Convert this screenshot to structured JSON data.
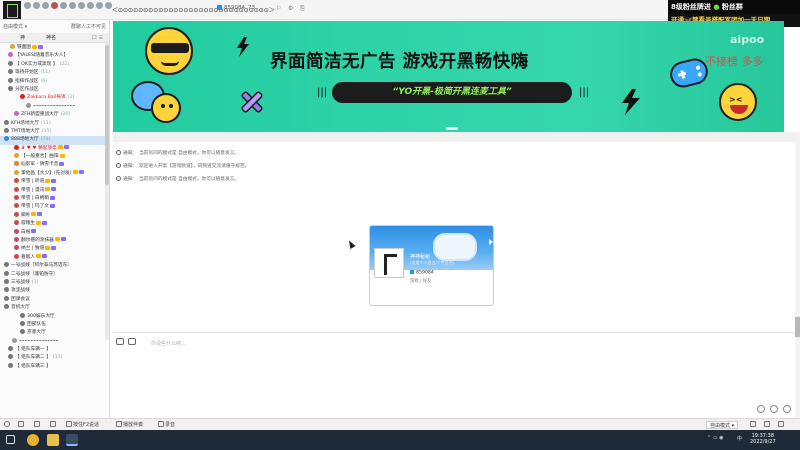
{
  "topbar": {
    "title": "＜⊙⊙⊙⊙⊙⊙⊙⊙⊙⊙⊙⊙⊙⊙⊙⊙⊙⊙⊙⊙⊙⊙⊙⊙⊙⊙⊙⊙⊙⊙＞",
    "channel_id": "859084",
    "people": "73",
    "icons": [
      "logo-icon",
      "group-icon",
      "chat-icon",
      "mute-icon",
      "settings-icon"
    ]
  },
  "overlay": {
    "line1_a": "8级粉丝牌进",
    "line1_b": "粉丝群",
    "line2": "开通🦋禁看号搭配军团加一天日期"
  },
  "sidebar": {
    "mode_label": "自由模式 ▾",
    "search_hint": "群聊人工不可见",
    "col_left": "神",
    "col_mid": "神名",
    "col_right": "口 ☰",
    "rows": [
      {
        "text": "铁面图",
        "indent": 10,
        "color": "#d6a63a",
        "badges": [
          "#ffb400",
          "#8a6cff"
        ]
      },
      {
        "text": "【YALESI随着音乐大人】",
        "indent": 8,
        "color": "#c06ac0",
        "count": ""
      },
      {
        "text": "【 OK实力或黑现 】",
        "indent": 8,
        "color": "#777",
        "count": "(22)"
      },
      {
        "text": "等待开始区",
        "indent": 8,
        "color": "#777",
        "count": "(11)"
      },
      {
        "text": "指挥作战区",
        "indent": 8,
        "color": "#777",
        "count": "(6)"
      },
      {
        "text": "分区作战区",
        "indent": 8,
        "color": "#777",
        "count": ""
      },
      {
        "text": "Zakkara Ball导演",
        "indent": 20,
        "color": "#d22",
        "count": "(2)"
      },
      {
        "text": "⌁⌁⌁⌁⌁⌁⌁⌁⌁⌁⌁⌁⌁⌁⌁",
        "indent": 26,
        "color": "#999",
        "count": ""
      },
      {
        "text": "ZFH新盟重战大厅",
        "indent": 14,
        "color": "#c06ac0",
        "count": "(26)"
      },
      {
        "text": "KFH场地大厅",
        "indent": 4,
        "color": "#777",
        "count": "(11)"
      },
      {
        "text": "TMT场地大厅",
        "indent": 4,
        "color": "#777",
        "count": "(35)"
      },
      {
        "text": "888场地大厅",
        "indent": 4,
        "color": "#2c8fe6",
        "count": "(70)",
        "selected": true
      },
      {
        "text": "♛ ♥ ♥     精起放电",
        "indent": 14,
        "color": "#d22",
        "badges": [
          "#ffb400",
          "#8a6cff"
        ]
      },
      {
        "text": "【一般重合】曲阳",
        "indent": 14,
        "color": "#d6a63a",
        "badges": [
          "#ffb400"
        ]
      },
      {
        "text": "仙影军 - 倩雪卡音",
        "indent": 14,
        "color": "#e87c27",
        "badges": [
          "#8a6cff"
        ]
      },
      {
        "text": "掌他昌【大少】(先对发)",
        "indent": 14,
        "color": "#d6a63a",
        "badges": [
          "#ffb400",
          "#8a6cff"
        ]
      },
      {
        "text": "帝雪 | 听道",
        "indent": 14,
        "color": "#c05050",
        "badges": [
          "#ffb400",
          "#8a6cff"
        ]
      },
      {
        "text": "帝雪 | 漫讯",
        "indent": 14,
        "color": "#c05050",
        "badges": [
          "#ffb400",
          "#8a6cff"
        ]
      },
      {
        "text": "帝雪 | 白柄鞘",
        "indent": 14,
        "color": "#c05050",
        "badges": [
          "#8a6cff"
        ]
      },
      {
        "text": "帝雪 | 玛丁文",
        "indent": 14,
        "color": "#c05050",
        "badges": [
          "#8a6cff"
        ]
      },
      {
        "text": "脚朴",
        "indent": 14,
        "color": "#c05050",
        "badges": [
          "#ffb400",
          "#8a6cff"
        ]
      },
      {
        "text": "寂粮生",
        "indent": 14,
        "color": "#c05050",
        "badges": [
          "#ffb400",
          "#8a6cff"
        ]
      },
      {
        "text": "白根",
        "indent": 14,
        "color": "#c05050",
        "badges": [
          "#8a6cff"
        ]
      },
      {
        "text": "翻尔擅的涂抹器",
        "indent": 14,
        "color": "#c05050",
        "badges": [
          "#ffb400",
          "#8a6cff"
        ]
      },
      {
        "text": "纳兰 | 独值",
        "indent": 14,
        "color": "#c05050",
        "badges": [
          "#ffb400",
          "#8a6cff"
        ]
      },
      {
        "text": "看敌人",
        "indent": 14,
        "color": "#c05050",
        "badges": [
          "#ffb400",
          "#8a6cff"
        ]
      },
      {
        "text": "一号战线（阿尔泰马苏迈东）",
        "indent": 4,
        "color": "#777",
        "count": ""
      },
      {
        "text": "二号战线（蓬铂防守）",
        "indent": 4,
        "color": "#777",
        "count": ""
      },
      {
        "text": "三号战线",
        "indent": 4,
        "color": "#777",
        "count": "(1)"
      },
      {
        "text": "攻坚战线",
        "indent": 4,
        "color": "#777",
        "count": ""
      },
      {
        "text": "团课会议",
        "indent": 4,
        "color": "#777",
        "count": ""
      },
      {
        "text": "音机大厅",
        "indent": 4,
        "color": "#777",
        "count": ""
      },
      {
        "text": "300娱乐大厅",
        "indent": 20,
        "color": "#777",
        "count": ""
      },
      {
        "text": "团部队伍",
        "indent": 20,
        "color": "#777",
        "count": ""
      },
      {
        "text": "京墨大厅",
        "indent": 20,
        "color": "#777",
        "count": ""
      },
      {
        "text": "⌁⌁⌁⌁⌁⌁⌁⌁⌁⌁⌁⌁⌁⌁",
        "indent": 12,
        "color": "#999",
        "count": ""
      },
      {
        "text": "【     组队车辆一     】",
        "indent": 8,
        "color": "#777",
        "count": ""
      },
      {
        "text": "【     组队车辆二     】",
        "indent": 8,
        "color": "#777",
        "count": "(11)"
      },
      {
        "text": "【     组队车辆三     】",
        "indent": 8,
        "color": "#777",
        "count": ""
      }
    ]
  },
  "banner": {
    "title": "界面简洁无广告  游戏开黑畅快嗨",
    "pill": "“YO开黑-极简开黑连麦工具”",
    "watermark": "aipoo",
    "watermark2": "不接榜 多多"
  },
  "notices": [
    {
      "label": "通知：",
      "msg": "当前房间的模式是 自由模式，你可以随意发言。"
    },
    {
      "label": "通知：",
      "msg": "欢迎进入开黑【游戏频道】，同频道交流请遵守规范。"
    },
    {
      "label": "通知：",
      "msg": "当前房间的模式是 自由模式，你可以随意发言。"
    }
  ],
  "card": {
    "name": "神神秘秘",
    "sub": "(这是个人签名/个性签名)",
    "id": "859084",
    "line": "游戏 | 好友"
  },
  "input": {
    "placeholder": "你说些什么吧..."
  },
  "bottombar": {
    "items": [
      "按住F2说话",
      "播放伴奏",
      "录音"
    ],
    "mode": "自由模式",
    "mode_arrow": "▾"
  },
  "taskbar": {
    "time": "19:37:38",
    "date": "2022/9/27",
    "ime": "中"
  },
  "colors": {
    "banner": "#2fd3a8",
    "accent": "#2c8fe6",
    "pill_text": "#8df25a"
  }
}
